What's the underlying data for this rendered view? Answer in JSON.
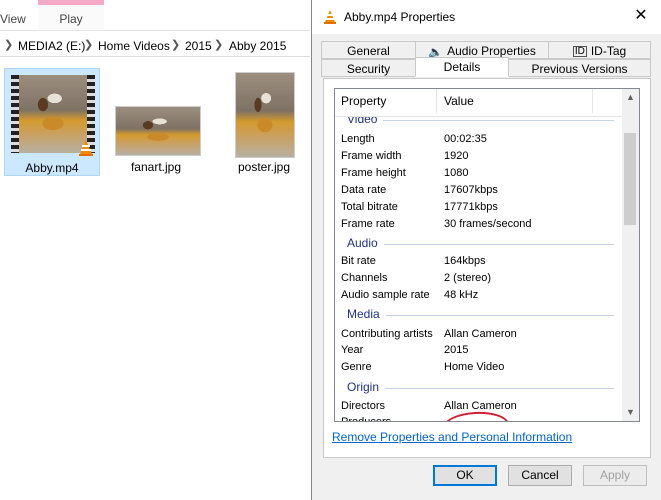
{
  "explorer": {
    "ribbon_tabs": [
      "View",
      "Play"
    ],
    "breadcrumb": [
      "MEDIA2 (E:)",
      "Home Videos",
      "2015",
      "Abby 2015"
    ],
    "files": [
      {
        "name": "Abby.mp4",
        "type": "video"
      },
      {
        "name": "fanart.jpg",
        "type": "image"
      },
      {
        "name": "poster.jpg",
        "type": "image"
      }
    ]
  },
  "dialog": {
    "title": "Abby.mp4 Properties",
    "close_symbol": "✕",
    "tabs_row1": [
      "General",
      "Audio Properties",
      "ID-Tag"
    ],
    "tabs_row2": [
      "Security",
      "Details",
      "Previous Versions"
    ],
    "active_tab": "Details",
    "columns": {
      "property": "Property",
      "value": "Value"
    },
    "partial_group": "Video",
    "video_rows": [
      {
        "k": "Length",
        "v": "00:02:35"
      },
      {
        "k": "Frame width",
        "v": "1920"
      },
      {
        "k": "Frame height",
        "v": "1080"
      },
      {
        "k": "Data rate",
        "v": "17607kbps"
      },
      {
        "k": "Total bitrate",
        "v": "17771kbps"
      },
      {
        "k": "Frame rate",
        "v": "30 frames/second"
      }
    ],
    "group_audio": "Audio",
    "audio_rows": [
      {
        "k": "Bit rate",
        "v": "164kbps"
      },
      {
        "k": "Channels",
        "v": "2 (stereo)"
      },
      {
        "k": "Audio sample rate",
        "v": "48 kHz"
      }
    ],
    "group_media": "Media",
    "media_rows": [
      {
        "k": "Contributing artists",
        "v": "Allan Cameron"
      },
      {
        "k": "Year",
        "v": "2015"
      },
      {
        "k": "Genre",
        "v": "Home Video"
      }
    ],
    "group_origin": "Origin",
    "origin_rows": [
      {
        "k": "Directors",
        "v": "Allan Cameron"
      },
      {
        "k": "Producers",
        "v": ""
      }
    ],
    "remove_link": "Remove Properties and Personal Information",
    "buttons": {
      "ok": "OK",
      "cancel": "Cancel",
      "apply": "Apply"
    },
    "colors": {
      "group": "#1e3287",
      "link": "#0066cc",
      "annotation": "#d02030"
    }
  }
}
